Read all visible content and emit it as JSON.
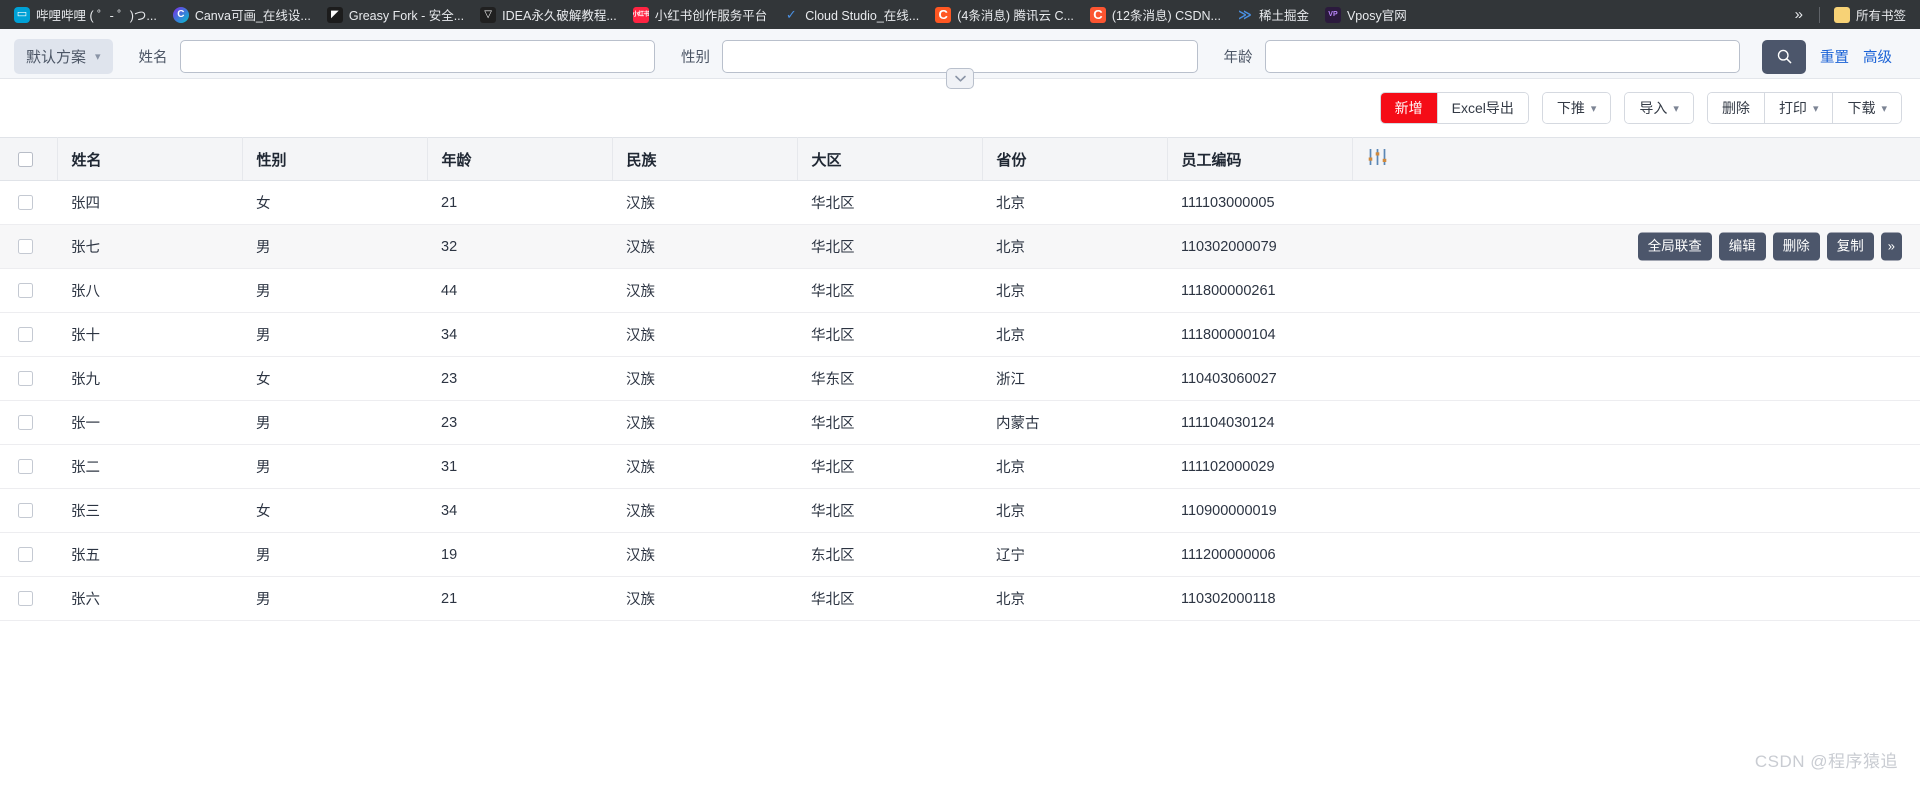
{
  "browser": {
    "bookmarks": [
      {
        "label": "哔哩哔哩 ( ゜- ゜)つ...",
        "icon": "bilibili-icon",
        "icon_class": "ico-bili",
        "glyph": "▭"
      },
      {
        "label": "Canva可画_在线设...",
        "icon": "canva-icon",
        "icon_class": "ico-canva",
        "glyph": "C"
      },
      {
        "label": "Greasy Fork - 安全...",
        "icon": "greasyfork-icon",
        "icon_class": "ico-greasy",
        "glyph": "◤"
      },
      {
        "label": "IDEA永久破解教程...",
        "icon": "idea-icon",
        "icon_class": "ico-idea",
        "glyph": "▽"
      },
      {
        "label": "小红书创作服务平台",
        "icon": "xiaohongshu-icon",
        "icon_class": "ico-xhs",
        "glyph": "小红书"
      },
      {
        "label": "Cloud Studio_在线...",
        "icon": "cloudstudio-icon",
        "icon_class": "ico-cloud",
        "glyph": "✓"
      },
      {
        "label": "(4条消息) 腾讯云 C...",
        "icon": "tencent-cloud-icon",
        "icon_class": "ico-tx",
        "glyph": "C"
      },
      {
        "label": "(12条消息) CSDN...",
        "icon": "csdn-icon",
        "icon_class": "ico-csdn",
        "glyph": "C"
      },
      {
        "label": "稀土掘金",
        "icon": "juejin-icon",
        "icon_class": "ico-juejin",
        "glyph": "≫"
      },
      {
        "label": "Vposy官网",
        "icon": "vposy-icon",
        "icon_class": "ico-vposy",
        "glyph": "VP"
      }
    ],
    "overflow_label": "»",
    "all_bookmarks": {
      "label": "所有书签",
      "icon": "folder-icon",
      "icon_class": "ico-folder",
      "glyph": "▬"
    }
  },
  "filter": {
    "scheme_label": "默认方案",
    "fields": [
      {
        "label": "姓名",
        "value": "",
        "placeholder": ""
      },
      {
        "label": "性别",
        "value": "",
        "placeholder": ""
      },
      {
        "label": "年龄",
        "value": "",
        "placeholder": ""
      }
    ],
    "reset_label": "重置",
    "advanced_label": "高级",
    "search_icon": "search-icon",
    "collapse_icon": "chevron-down-icon"
  },
  "toolbar": {
    "groups": [
      {
        "buttons": [
          {
            "label": "新增",
            "style": "primary",
            "caret": false
          },
          {
            "label": "Excel导出",
            "style": "default",
            "caret": false
          }
        ]
      },
      {
        "buttons": [
          {
            "label": "下推",
            "style": "default",
            "caret": true
          }
        ]
      },
      {
        "buttons": [
          {
            "label": "导入",
            "style": "default",
            "caret": true
          }
        ]
      },
      {
        "buttons": [
          {
            "label": "删除",
            "style": "default",
            "caret": false
          },
          {
            "label": "打印",
            "style": "default",
            "caret": true
          },
          {
            "label": "下载",
            "style": "default",
            "caret": true
          }
        ]
      }
    ]
  },
  "table": {
    "settings_icon": "sliders-icon",
    "columns": [
      "姓名",
      "性别",
      "年龄",
      "民族",
      "大区",
      "省份",
      "员工编码"
    ],
    "rows": [
      {
        "姓名": "张四",
        "性别": "女",
        "年龄": "21",
        "民族": "汉族",
        "大区": "华北区",
        "省份": "北京",
        "员工编码": "111103000005"
      },
      {
        "姓名": "张七",
        "性别": "男",
        "年龄": "32",
        "民族": "汉族",
        "大区": "华北区",
        "省份": "北京",
        "员工编码": "110302000079"
      },
      {
        "姓名": "张八",
        "性别": "男",
        "年龄": "44",
        "民族": "汉族",
        "大区": "华北区",
        "省份": "北京",
        "员工编码": "111800000261"
      },
      {
        "姓名": "张十",
        "性别": "男",
        "年龄": "34",
        "民族": "汉族",
        "大区": "华北区",
        "省份": "北京",
        "员工编码": "111800000104"
      },
      {
        "姓名": "张九",
        "性别": "女",
        "年龄": "23",
        "民族": "汉族",
        "大区": "华东区",
        "省份": "浙江",
        "员工编码": "110403060027"
      },
      {
        "姓名": "张一",
        "性别": "男",
        "年龄": "23",
        "民族": "汉族",
        "大区": "华北区",
        "省份": "内蒙古",
        "员工编码": "111104030124"
      },
      {
        "姓名": "张二",
        "性别": "男",
        "年龄": "31",
        "民族": "汉族",
        "大区": "华北区",
        "省份": "北京",
        "员工编码": "111102000029"
      },
      {
        "姓名": "张三",
        "性别": "女",
        "年龄": "34",
        "民族": "汉族",
        "大区": "华北区",
        "省份": "北京",
        "员工编码": "110900000019"
      },
      {
        "姓名": "张五",
        "性别": "男",
        "年龄": "19",
        "民族": "汉族",
        "大区": "东北区",
        "省份": "辽宁",
        "员工编码": "111200000006"
      },
      {
        "姓名": "张六",
        "性别": "男",
        "年龄": "21",
        "民族": "汉族",
        "大区": "华北区",
        "省份": "北京",
        "员工编码": "110302000118"
      }
    ],
    "hovered_row_index": 1,
    "row_actions": [
      "全局联查",
      "编辑",
      "删除",
      "复制"
    ],
    "row_actions_more": "»"
  },
  "watermark": "CSDN @程序猿追",
  "colors": {
    "primary_red": "#f50c17",
    "link_blue": "#1a62d6",
    "dark_slate": "#4c566b",
    "bar_bg": "#323639",
    "filter_bg": "#f5f7fa"
  }
}
